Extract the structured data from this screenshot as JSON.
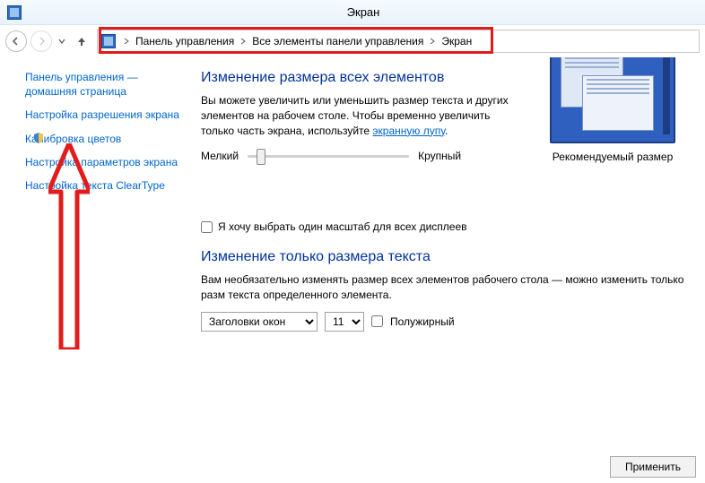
{
  "window": {
    "title": "Экран"
  },
  "breadcrumb": {
    "segments": [
      "Панель управления",
      "Все элементы панели управления",
      "Экран"
    ]
  },
  "sidebar": {
    "home": "Панель управления — домашняя страница",
    "links": [
      "Настройка разрешения экрана",
      "Калибровка цветов",
      "Настройка параметров экрана",
      "Настройка текста ClearType"
    ]
  },
  "section1": {
    "heading": "Изменение размера всех элементов",
    "desc_part1": "Вы можете увеличить или уменьшить размер текста и других элементов на рабочем столе. Чтобы временно увеличить только часть экрана, используйте ",
    "desc_link": "экранную лупу",
    "desc_part2": ".",
    "slider_min": "Мелкий",
    "slider_max": "Крупный",
    "preview_caption": "Рекомендуемый размер",
    "checkbox": "Я хочу выбрать один масштаб для всех дисплеев"
  },
  "section2": {
    "heading": "Изменение только размера текста",
    "desc": "Вам необязательно изменять размер всех элементов рабочего стола — можно изменить только разм текста определенного элемента.",
    "select_element": "Заголовки окон",
    "select_size": "11",
    "bold_label": "Полужирный"
  },
  "footer": {
    "apply": "Применить"
  }
}
